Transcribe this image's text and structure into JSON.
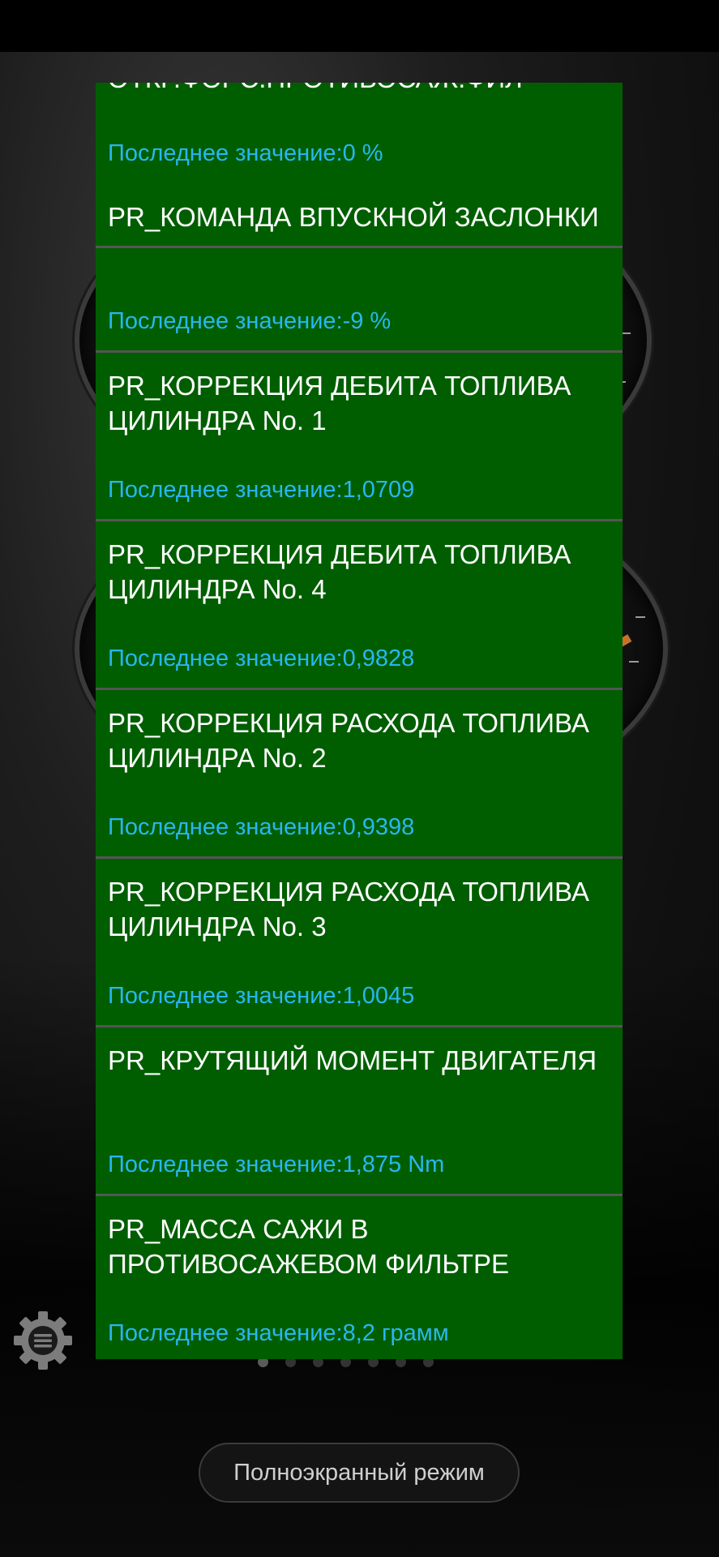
{
  "list": {
    "items": [
      {
        "title": "ОТКР.ФОРС.ПРОТИВОСАЖ.ФИЛ",
        "value": "Последнее значение:0 %"
      },
      {
        "title": "PR_КОМАНДА ВПУСКНОЙ ЗАСЛОНКИ",
        "value": "Последнее значение:-9 %"
      },
      {
        "title": "PR_КОРРЕКЦИЯ ДЕБИТА ТОПЛИВА ЦИЛИНДРА No. 1",
        "value": "Последнее значение:1,0709"
      },
      {
        "title": "PR_КОРРЕКЦИЯ ДЕБИТА ТОПЛИВА ЦИЛИНДРА No. 4",
        "value": "Последнее значение:0,9828"
      },
      {
        "title": "PR_КОРРЕКЦИЯ РАСХОДА ТОПЛИВА ЦИЛИНДРА No. 2",
        "value": "Последнее значение:0,9398"
      },
      {
        "title": "PR_КОРРЕКЦИЯ РАСХОДА ТОПЛИВА ЦИЛИНДРА No. 3",
        "value": "Последнее значение:1,0045"
      },
      {
        "title": "PR_КРУТЯЩИЙ МОМЕНТ ДВИГАТЕЛЯ",
        "value": "Последнее значение:1,875 Nm"
      },
      {
        "title": "PR_МАССА САЖИ В ПРОТИВОСАЖЕВОМ ФИЛЬТРЕ",
        "value": "Последнее значение:8,2 грамм"
      }
    ]
  },
  "pager": {
    "count": 7,
    "active_index": 0
  },
  "fullscreen_button": {
    "label": "Полноэкранный режим"
  },
  "icons": {
    "settings": "gear-menu-icon"
  },
  "colors": {
    "panel_bg": "#005e00",
    "value_text": "#29b6f0",
    "title_text": "#ffffff",
    "divider": "#555555"
  }
}
